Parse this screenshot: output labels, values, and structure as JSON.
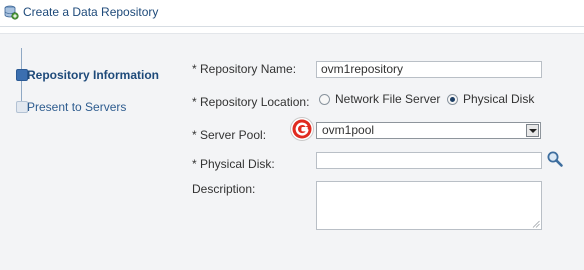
{
  "window": {
    "title": "Create a Data Repository",
    "title_icon": "database-add-icon"
  },
  "train": {
    "steps": [
      {
        "label": "Repository Information",
        "state": "current"
      },
      {
        "label": "Present to Servers",
        "state": "pending"
      }
    ]
  },
  "form": {
    "repository_name": {
      "label": "* Repository Name:",
      "value": "ovm1repository"
    },
    "repository_location": {
      "label": "* Repository Location:",
      "options": [
        {
          "label": "Network File Server",
          "selected": false
        },
        {
          "label": "Physical Disk",
          "selected": true
        }
      ]
    },
    "server_pool": {
      "label": "* Server Pool:",
      "value": "ovm1pool",
      "overlay_icon": "g-logo-icon"
    },
    "physical_disk": {
      "label": "* Physical Disk:",
      "value": "",
      "search_icon": "search-icon"
    },
    "description": {
      "label": "Description:",
      "value": ""
    }
  },
  "colors": {
    "title_text": "#1e4a7a",
    "panel_background": "#f3f4f6",
    "current_step": "#3b6fb0",
    "g_badge_red": "#e02b20"
  }
}
